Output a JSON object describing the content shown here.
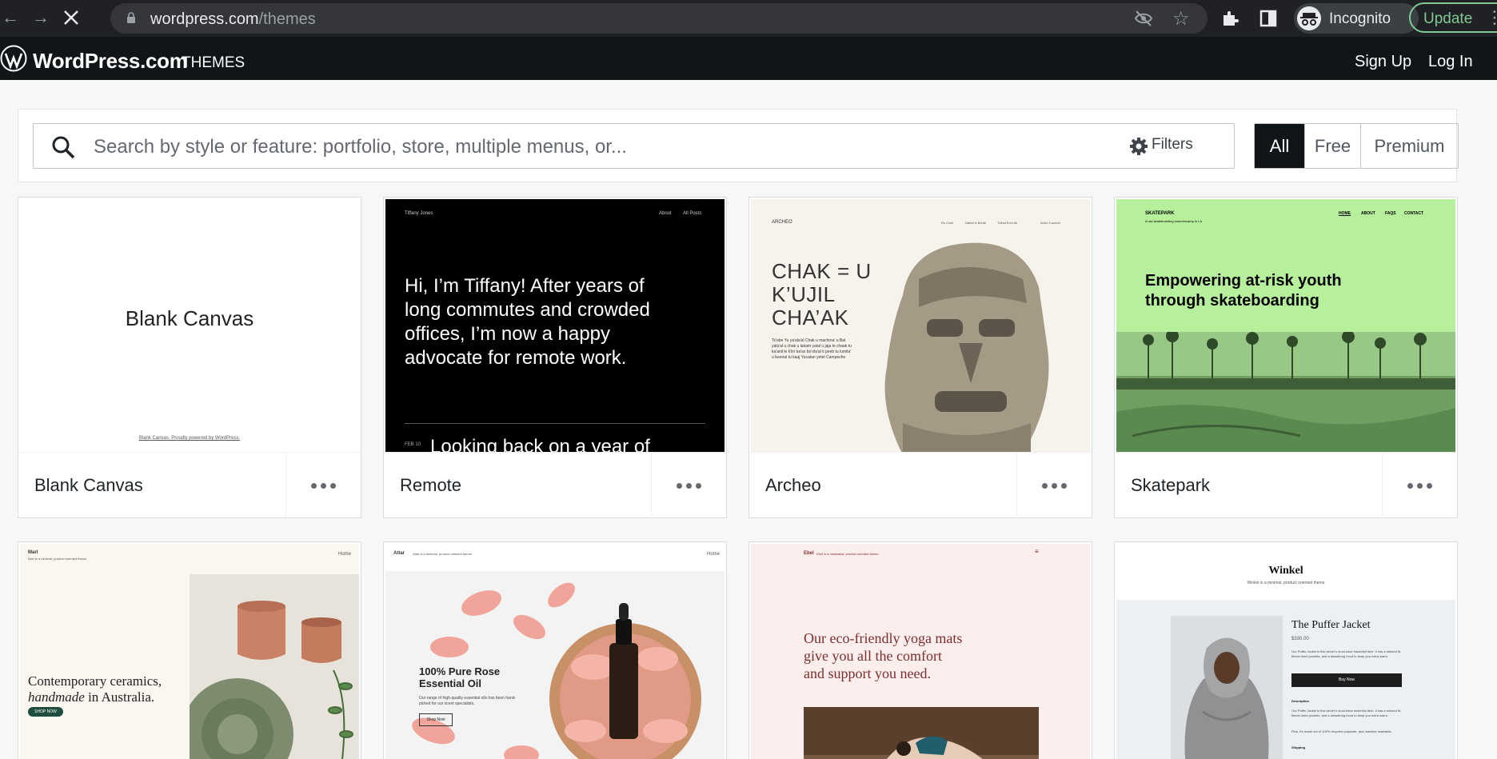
{
  "browser": {
    "url_host": "wordpress.com",
    "url_path": "/themes",
    "profile_label": "Incognito",
    "update_label": "Update"
  },
  "header": {
    "brand": "WordPress.com",
    "section": "THEMES",
    "signup": "Sign Up",
    "login": "Log In"
  },
  "search": {
    "placeholder": "Search by style or feature: portfolio, store, multiple menus, or...",
    "filters_label": "Filters"
  },
  "tier_filter": {
    "options": [
      "All",
      "Free",
      "Premium"
    ],
    "selected": "All"
  },
  "themes": [
    {
      "name": "Blank Canvas",
      "preview": {
        "title": "Blank Canvas",
        "footer": "Blank Canvas. Proudly powered by WordPress."
      }
    },
    {
      "name": "Remote",
      "preview": {
        "site": "Tiffany Jones",
        "nav": [
          "About",
          "All Posts"
        ],
        "headline": "Hi, I’m Tiffany! After years of long commutes and crowded offices, I’m now a happy advocate for remote work.",
        "date": "FEB 10",
        "post": "Looking back on a year of"
      }
    },
    {
      "name": "Archeo",
      "preview": {
        "site": "ARCHEO",
        "nav": [
          "Ru Cwiil",
          "Nabal Ix Ba'ab",
          "Tzibal Echi Ab",
          "Ankil J'uumoh"
        ],
        "headline": "CHAK = U K’UJIL CHA’AK",
        "body": "Ts'ebe Yu ya'ala'al Chak u machma' u Bal yala'al u chak u lakam yatal u jaja le chaak tu ka'anil le k'iin ba'ax bo'ola'al ti peeb tu lumila' u beenal tu kaaj Yucatan yetel Campeche"
      }
    },
    {
      "name": "Skatepark",
      "preview": {
        "site": "SKATEPARK",
        "tagline": "A rad skateboarding summercamp in LA",
        "nav": [
          "HOME",
          "ABOUT",
          "FAQS",
          "CONTACT"
        ],
        "headline": "Empowering at-risk youth through skateboarding"
      }
    },
    {
      "name": "Marl",
      "preview": {
        "site": "Marl",
        "tagline": "Marl is a minimal, product oriented theme",
        "nav": [
          "Home"
        ],
        "headline_a": "Contemporary ceramics,",
        "headline_b": "handmade",
        "headline_c": " in Australia.",
        "cta": "SHOP NOW"
      }
    },
    {
      "name": "Attar",
      "preview": {
        "site": "Attar",
        "tagline": "Attar is a minimal, product oriented theme",
        "nav": [
          "Home"
        ],
        "headline": "100% Pure Rose Essential Oil",
        "body": "Our range of high-quality essential oils has been hand-picked for our scent specialists.",
        "cta": "Shop Now"
      }
    },
    {
      "name": "Ebel",
      "preview": {
        "site": "Ebel",
        "tagline": "Ebel is a minimalist, product oriented theme",
        "headline": "Our eco-friendly yoga mats give you all the comfort and support you need."
      }
    },
    {
      "name": "Winkel",
      "preview": {
        "site": "Winkel",
        "tagline": "Winkel is a minimal, product oriented theme",
        "product": "The Puffer Jacket",
        "price": "$330.00",
        "body": "Our Puffer Jacket is this winter's must-have essential item. It has a relaxed fit, fleece-lined pockets, and a drawstring hood to keep you extra warm.",
        "cta": "Buy Now",
        "desc_title": "Description",
        "desc": "Our Puffer Jacket is this winter's must-have essential item. It has a relaxed fit, fleece-lined pockets, and a drawstring hood to keep you extra warm.",
        "desc2": "Plus, it's made out of 100% recycled polyester, and machine washable.",
        "shipping": "Shipping"
      }
    }
  ],
  "colors": {
    "wp_black": "#101517",
    "chrome_bg": "#202124",
    "skatepark_green": "#b6f09c",
    "archeo_bg": "#f6f3ed",
    "marl_bg": "#faf6f0",
    "ebel_bg": "#fbeeec",
    "ebel_text": "#7b2e2e"
  }
}
